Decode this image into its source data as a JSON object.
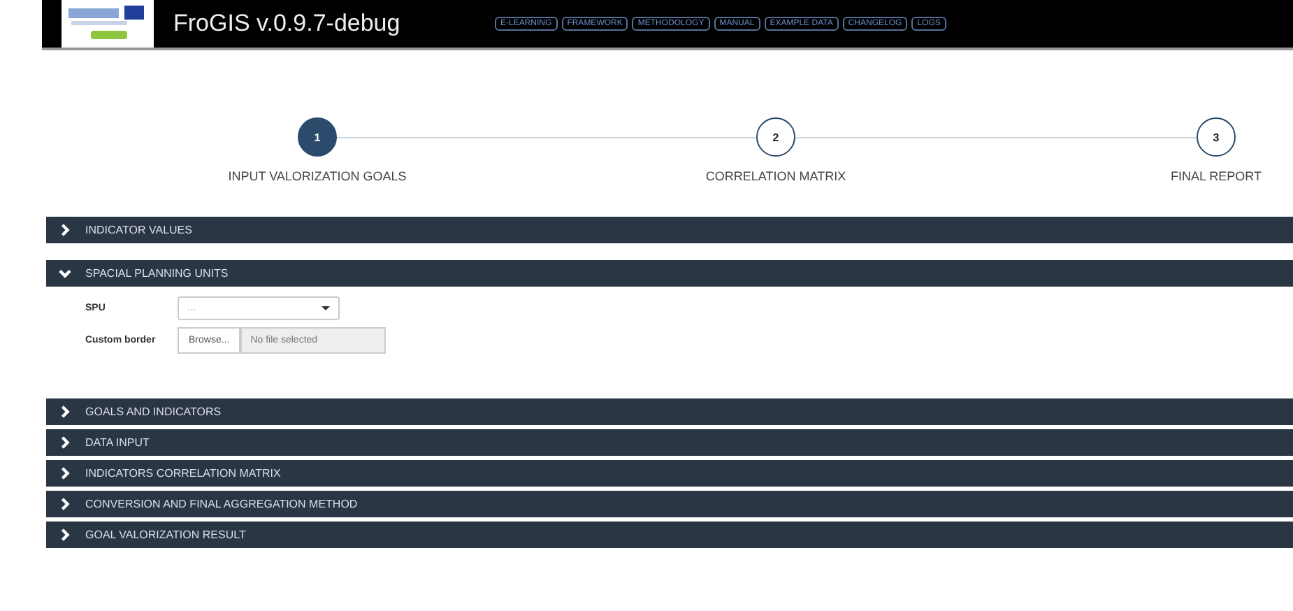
{
  "header": {
    "title": "FroGIS v.0.9.7-debug",
    "nav": [
      "E-LEARNING",
      "FRAMEWORK",
      "METHODOLOGY",
      "MANUAL",
      "EXAMPLE DATA",
      "CHANGELOG",
      "LOGS"
    ]
  },
  "steps": [
    {
      "number": "1",
      "label": "INPUT VALORIZATION GOALS",
      "selected": true
    },
    {
      "number": "2",
      "label": "CORRELATION MATRIX",
      "selected": false
    },
    {
      "number": "3",
      "label": "FINAL REPORT",
      "selected": false
    }
  ],
  "sections": [
    {
      "title": "INDICATOR VALUES",
      "expanded": false
    },
    {
      "title": "SPACIAL PLANNING UNITS",
      "expanded": true,
      "fields": [
        {
          "kind": "select",
          "label": "SPU",
          "value": "..."
        },
        {
          "kind": "file",
          "label": "Custom border",
          "button": "Browse...",
          "placeholder": "No file selected"
        }
      ]
    },
    {
      "title": "GOALS AND INDICATORS",
      "expanded": false
    },
    {
      "title": "DATA INPUT",
      "expanded": false
    },
    {
      "title": "INDICATORS CORRELATION MATRIX",
      "expanded": false
    },
    {
      "title": "CONVERSION AND FINAL AGGREGATION METHOD",
      "expanded": false
    },
    {
      "title": "GOAL VALORIZATION RESULT",
      "expanded": false
    }
  ]
}
